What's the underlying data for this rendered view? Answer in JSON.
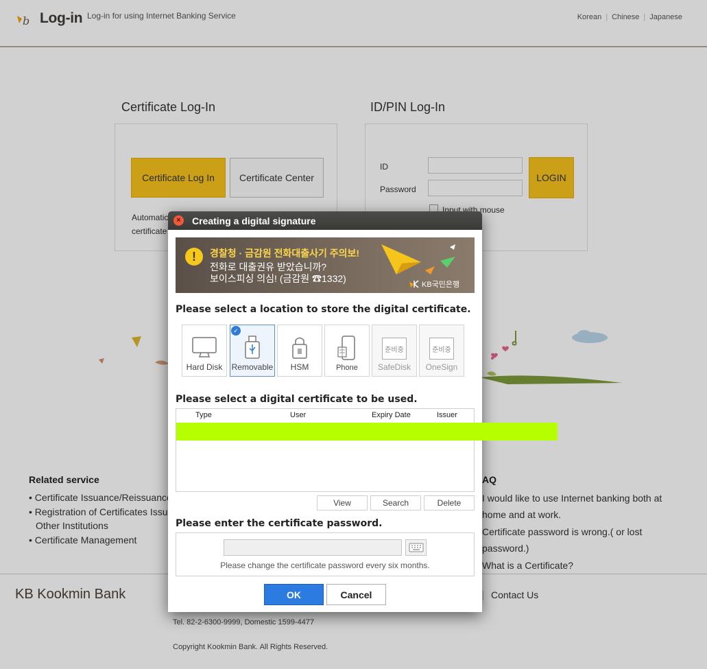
{
  "header": {
    "title": "Log-in",
    "subtitle": "Log-in for using Internet Banking Service",
    "languages": [
      "Korean",
      "Chinese",
      "Japanese"
    ]
  },
  "cert_login": {
    "title": "Certificate Log-In",
    "login_button": "Certificate Log In",
    "center_button": "Certificate Center",
    "note_line1": "Automatic",
    "note_line2": "certificate"
  },
  "id_login": {
    "title": "ID/PIN Log-In",
    "id_label": "ID",
    "password_label": "Password",
    "login_button": "LOGIN",
    "mouse_label": "Input with mouse"
  },
  "related": {
    "title": "Related service",
    "items": [
      "Certificate Issuance/Reissuance",
      "Registration of Certificates Issued by",
      "Other Institutions",
      "Certificate Management"
    ]
  },
  "faq": {
    "title": "AQ",
    "items": [
      "I would like to use Internet banking both at",
      "home and at work.",
      "Certificate password is wrong.( or lost",
      "password.)",
      "What is a Certificate?"
    ]
  },
  "footer": {
    "logo": "KB Kookmin Bank",
    "contact": "Contact Us",
    "tel": "Tel. 82-2-6300-9999, Domestic 1599-4477",
    "copyright": "Copyright Kookmin Bank. All Rights Reserved."
  },
  "dialog": {
    "title": "Creating a digital signature",
    "banner": {
      "line1": "경찰청 · 금감원 전화대출사기 주의보!",
      "line2": "전화로 대출권유 받았습니까?",
      "line3": "보이스피싱 의심! (금감원 ☎1332)",
      "brand": "KB국민은행"
    },
    "store_heading": "Please select a location to store the digital certificate.",
    "storage": [
      {
        "label": "Hard Disk",
        "icon": "monitor-icon"
      },
      {
        "label": "Removable",
        "icon": "usb-drive-icon",
        "selected": true
      },
      {
        "label": "HSM",
        "icon": "lock-icon"
      },
      {
        "label": "Phone",
        "icon": "phone-icon"
      },
      {
        "label": "SafeDisk",
        "icon": "preparing-icon",
        "icon_text": "준비중",
        "disabled": true
      },
      {
        "label": "OneSign",
        "icon": "preparing-icon",
        "icon_text": "준비중",
        "disabled": true
      }
    ],
    "cert_heading": "Please select a digital certificate to be used.",
    "columns": [
      "Type",
      "User",
      "Expiry Date",
      "Issuer"
    ],
    "buttons": {
      "view": "View",
      "search": "Search",
      "delete": "Delete"
    },
    "password_heading": "Please enter the certificate password.",
    "password_hint": "Please change the certificate password every six months.",
    "ok": "OK",
    "cancel": "Cancel"
  },
  "colors": {
    "accent_yellow": "#f8c41c",
    "ok_blue": "#2c7be0",
    "highlight": "#b5ff00",
    "header_line": "#b8a990"
  }
}
